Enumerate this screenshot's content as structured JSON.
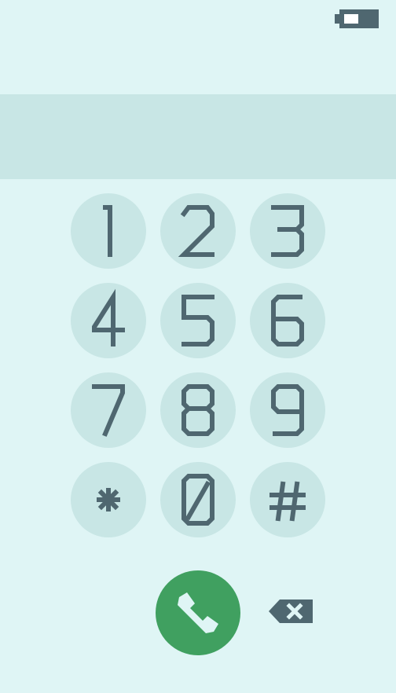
{
  "display": {
    "dialed_number": ""
  },
  "status_bar": {
    "battery_icon": "battery-low-icon"
  },
  "keypad": {
    "keys": [
      {
        "label": "1"
      },
      {
        "label": "2"
      },
      {
        "label": "3"
      },
      {
        "label": "4"
      },
      {
        "label": "5"
      },
      {
        "label": "6"
      },
      {
        "label": "7"
      },
      {
        "label": "8"
      },
      {
        "label": "9"
      },
      {
        "label": "*"
      },
      {
        "label": "0"
      },
      {
        "label": "#"
      }
    ]
  },
  "actions": {
    "call_icon": "phone-icon",
    "backspace_icon": "backspace-icon"
  },
  "colors": {
    "background": "#dff5f5",
    "key_background": "#c8e6e5",
    "glyph": "#4f6770",
    "call_button": "#40a060"
  }
}
